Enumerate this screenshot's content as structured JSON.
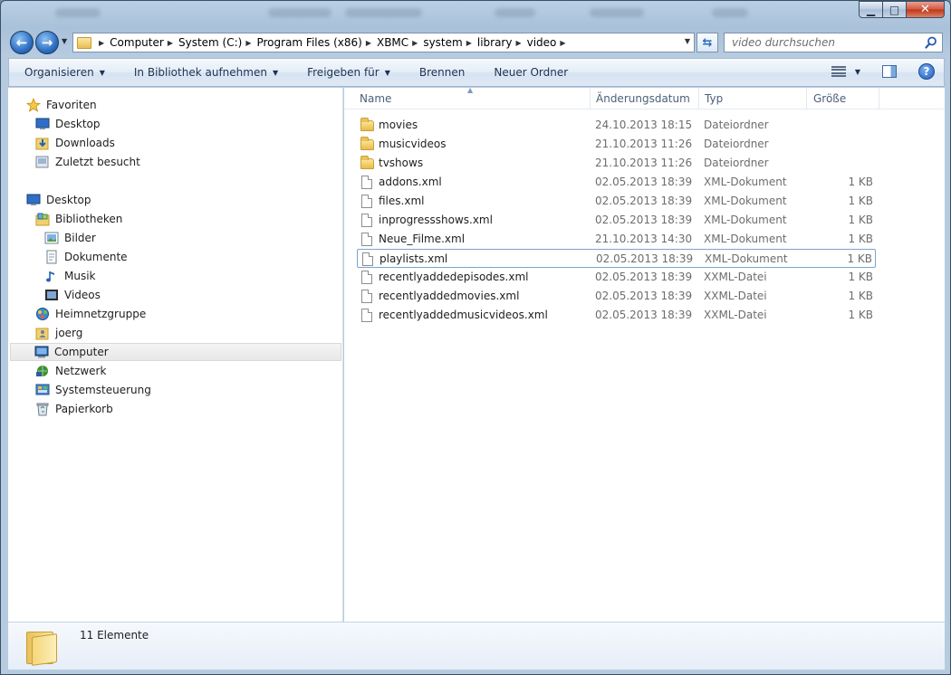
{
  "window": {
    "caption": {
      "minimize": "▁",
      "maximize": "□",
      "close": "✕"
    }
  },
  "navigation": {
    "back": "←",
    "forward": "→",
    "breadcrumbs": [
      "Computer",
      "System (C:)",
      "Program Files (x86)",
      "XBMC",
      "system",
      "library",
      "video"
    ],
    "search_placeholder": "video durchsuchen"
  },
  "toolbar": {
    "organize": "Organisieren",
    "add_to_library": "In Bibliothek aufnehmen",
    "share_with": "Freigeben für",
    "burn": "Brennen",
    "new_folder": "Neuer Ordner",
    "help": "?"
  },
  "sidebar": {
    "favorites": "Favoriten",
    "desktop_fav": "Desktop",
    "downloads": "Downloads",
    "recent": "Zuletzt besucht",
    "desktop": "Desktop",
    "libraries": "Bibliotheken",
    "pictures": "Bilder",
    "documents": "Dokumente",
    "music": "Musik",
    "videos": "Videos",
    "homegroup": "Heimnetzgruppe",
    "user": "joerg",
    "computer": "Computer",
    "network": "Netzwerk",
    "control_panel": "Systemsteuerung",
    "recycle_bin": "Papierkorb"
  },
  "columns": {
    "name": "Name",
    "date": "Änderungsdatum",
    "type": "Typ",
    "size": "Größe"
  },
  "files": [
    {
      "name": "movies",
      "date": "24.10.2013 18:15",
      "type": "Dateiordner",
      "size": "",
      "kind": "folder"
    },
    {
      "name": "musicvideos",
      "date": "21.10.2013 11:26",
      "type": "Dateiordner",
      "size": "",
      "kind": "folder"
    },
    {
      "name": "tvshows",
      "date": "21.10.2013 11:26",
      "type": "Dateiordner",
      "size": "",
      "kind": "folder"
    },
    {
      "name": "addons.xml",
      "date": "02.05.2013 18:39",
      "type": "XML-Dokument",
      "size": "1 KB",
      "kind": "file"
    },
    {
      "name": "files.xml",
      "date": "02.05.2013 18:39",
      "type": "XML-Dokument",
      "size": "1 KB",
      "kind": "file"
    },
    {
      "name": "inprogressshows.xml",
      "date": "02.05.2013 18:39",
      "type": "XML-Dokument",
      "size": "1 KB",
      "kind": "file"
    },
    {
      "name": "Neue_Filme.xml",
      "date": "21.10.2013 14:30",
      "type": "XML-Dokument",
      "size": "1 KB",
      "kind": "file"
    },
    {
      "name": "playlists.xml",
      "date": "02.05.2013 18:39",
      "type": "XML-Dokument",
      "size": "1 KB",
      "kind": "file",
      "selected": true
    },
    {
      "name": "recentlyaddedepisodes.xml",
      "date": "02.05.2013 18:39",
      "type": "XXML-Datei",
      "size": "1 KB",
      "kind": "file"
    },
    {
      "name": "recentlyaddedmovies.xml",
      "date": "02.05.2013 18:39",
      "type": "XXML-Datei",
      "size": "1 KB",
      "kind": "file"
    },
    {
      "name": "recentlyaddedmusicvideos.xml",
      "date": "02.05.2013 18:39",
      "type": "XXML-Datei",
      "size": "1 KB",
      "kind": "file"
    }
  ],
  "status": {
    "count": "11 Elemente"
  },
  "colors": {
    "titlebar": "#b9cfe3",
    "selection_border": "#7da2ce",
    "close_button": "#c03415"
  }
}
